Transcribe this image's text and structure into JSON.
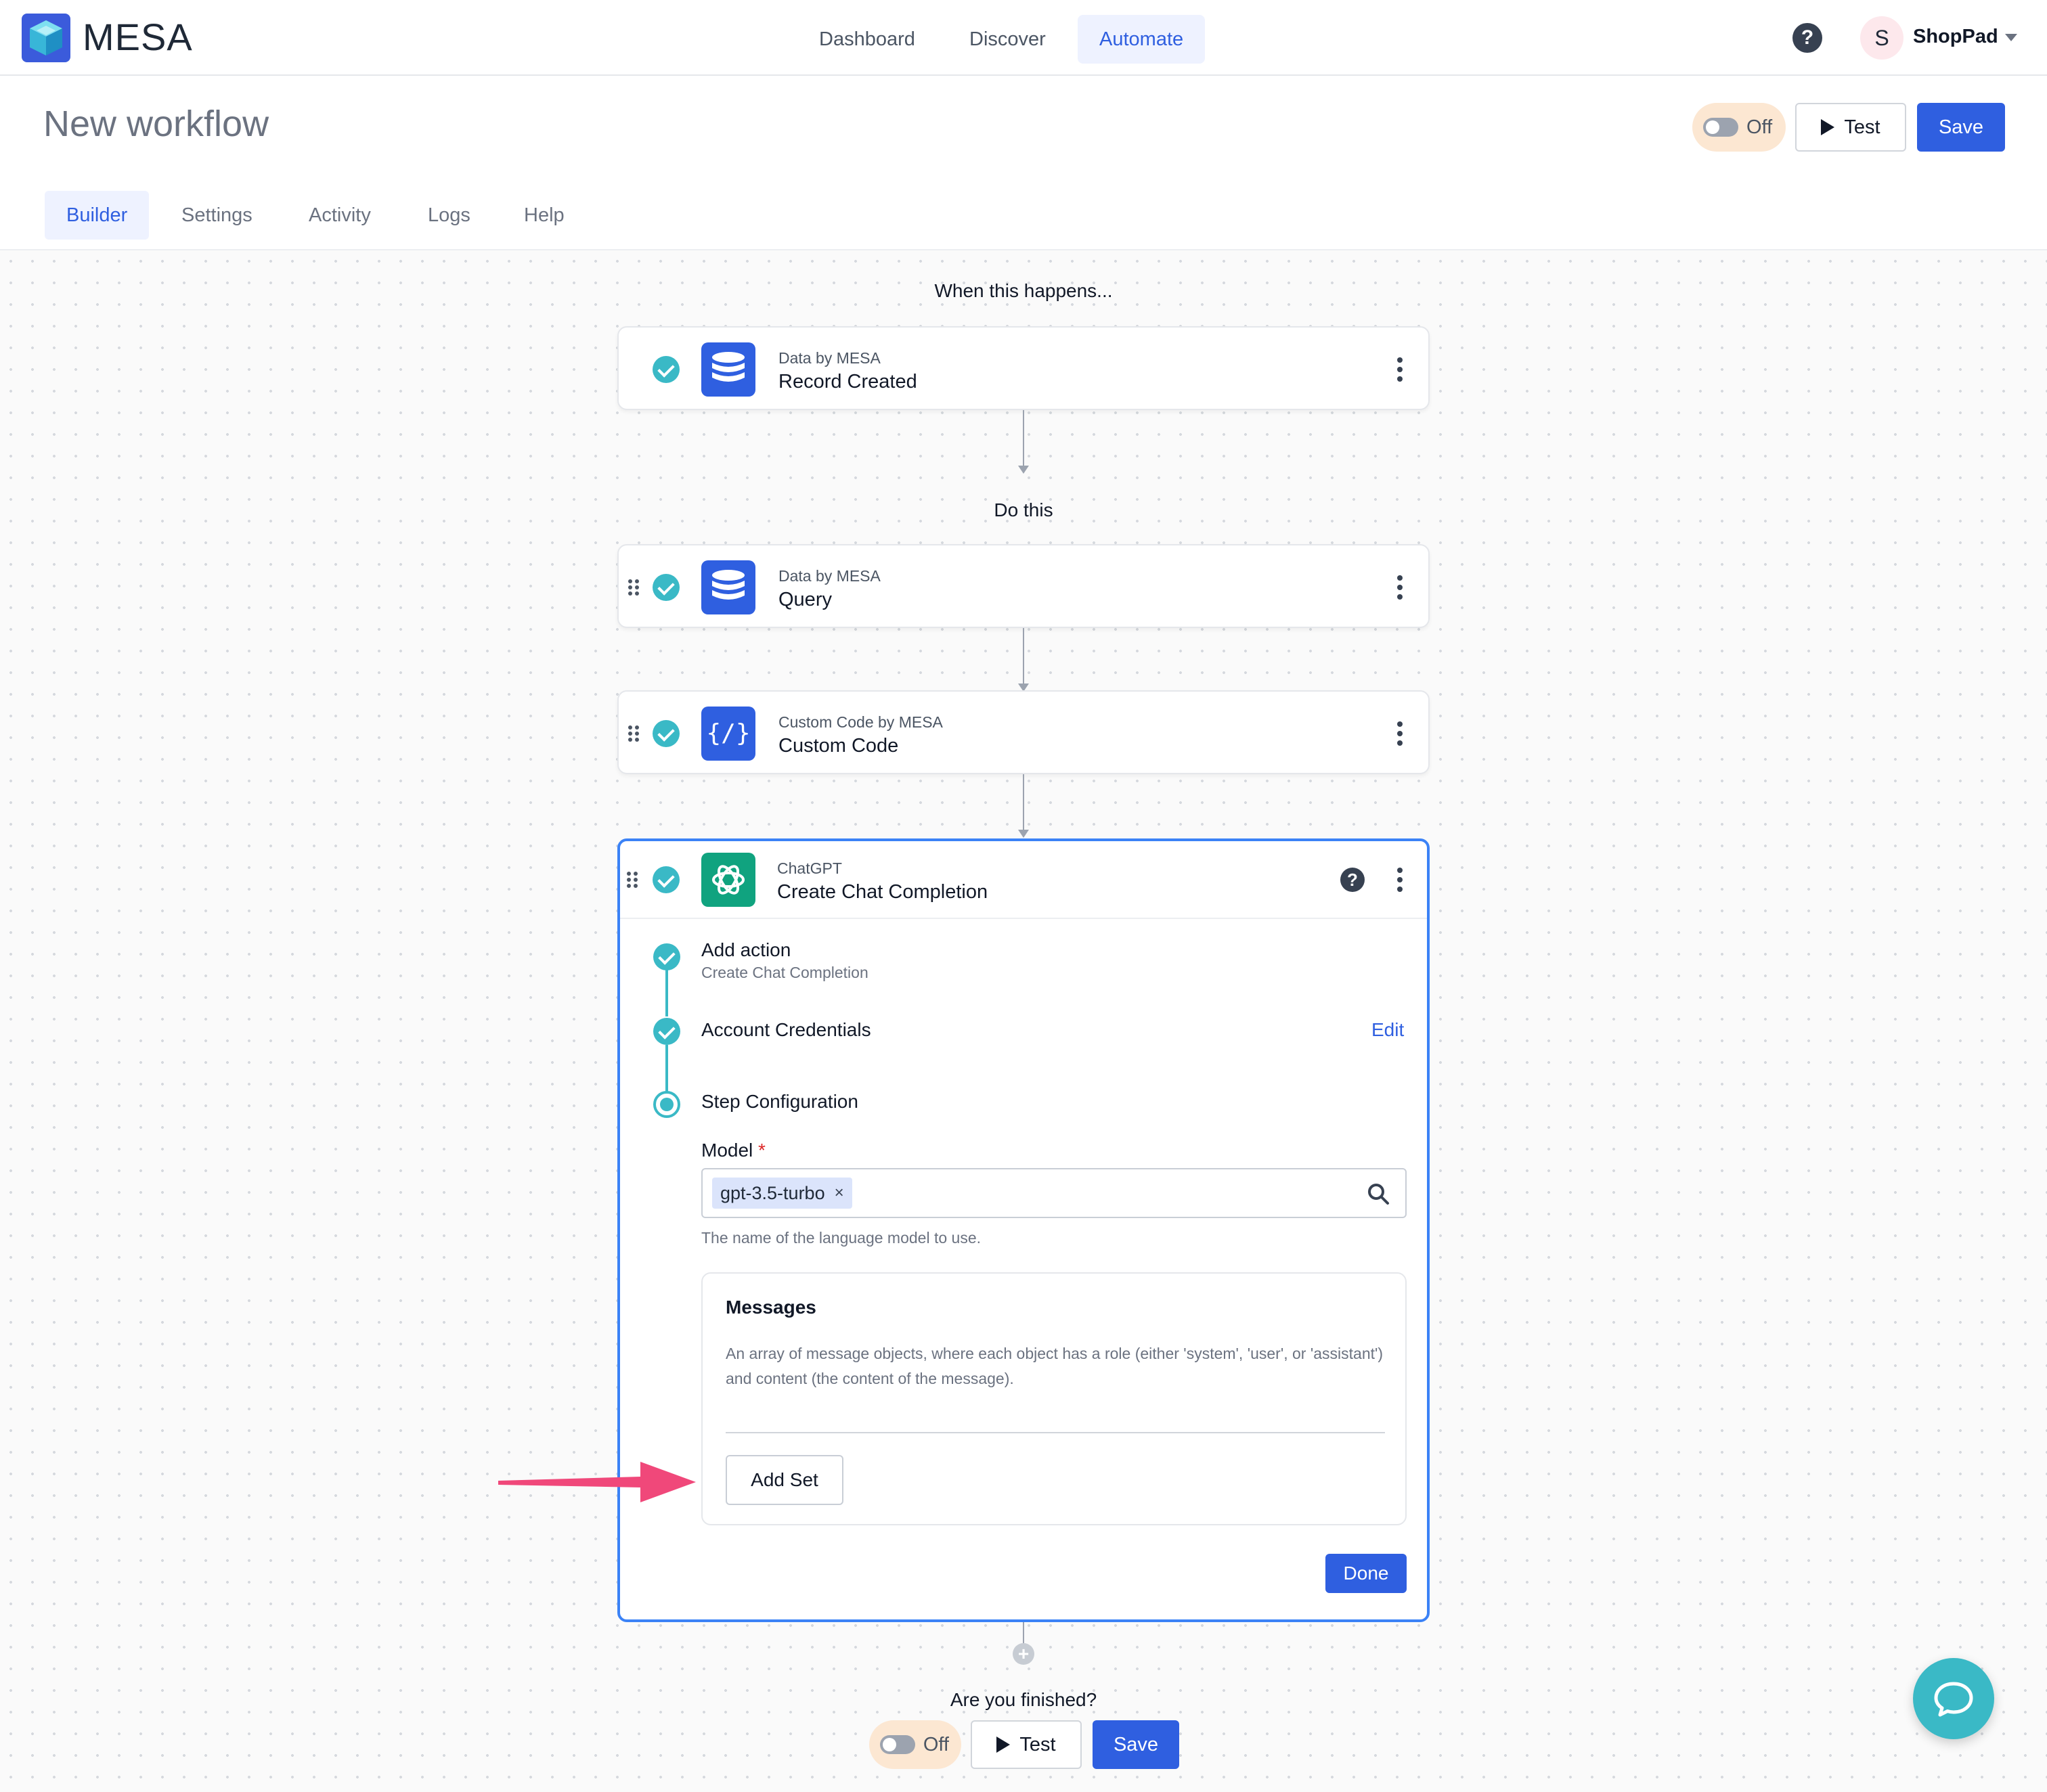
{
  "app": {
    "name": "MESA"
  },
  "nav": {
    "items": [
      {
        "label": "Dashboard",
        "active": false
      },
      {
        "label": "Discover",
        "active": false
      },
      {
        "label": "Automate",
        "active": true
      }
    ],
    "help_icon": "question-circle-icon",
    "account": {
      "initial": "S",
      "name": "ShopPad"
    }
  },
  "header": {
    "title": "New workflow",
    "toggle_label": "Off",
    "test_label": "Test",
    "save_label": "Save"
  },
  "tabs": [
    {
      "label": "Builder",
      "active": true
    },
    {
      "label": "Settings",
      "active": false
    },
    {
      "label": "Activity",
      "active": false
    },
    {
      "label": "Logs",
      "active": false
    },
    {
      "label": "Help",
      "active": false
    }
  ],
  "workflow": {
    "trigger_heading": "When this happens...",
    "actions_heading": "Do this",
    "steps": [
      {
        "app": "Data by MESA",
        "title": "Record Created",
        "icon": "database-icon"
      },
      {
        "app": "Data by MESA",
        "title": "Query",
        "icon": "database-icon"
      },
      {
        "app": "Custom Code by MESA",
        "title": "Custom Code",
        "icon": "code-icon",
        "icon_text": "{/}"
      },
      {
        "app": "ChatGPT",
        "title": "Create Chat Completion",
        "icon": "openai-icon"
      }
    ],
    "expanded": {
      "substeps": [
        {
          "label": "Add action",
          "sub": "Create Chat Completion"
        },
        {
          "label": "Account Credentials",
          "action": "Edit"
        },
        {
          "label": "Step Configuration"
        }
      ],
      "model_field": {
        "label": "Model",
        "required_mark": "*",
        "value": "gpt-3.5-turbo",
        "remove_glyph": "×",
        "help": "The name of the language model to use."
      },
      "messages": {
        "title": "Messages",
        "description": "An array of message objects, where each object has a role (either 'system', 'user', or 'assistant') and content (the content of the message).",
        "add_label": "Add Set"
      },
      "done_label": "Done"
    },
    "add_step_glyph": "+",
    "finish_prompt": "Are you finished?",
    "footer": {
      "toggle_label": "Off",
      "test_label": "Test",
      "save_label": "Save"
    }
  },
  "colors": {
    "primary": "#2f5fe0",
    "check": "#3ab9c6",
    "focus_border": "#3b82f6",
    "annotation_arrow": "#f0487a",
    "chatgpt": "#10a37f"
  }
}
